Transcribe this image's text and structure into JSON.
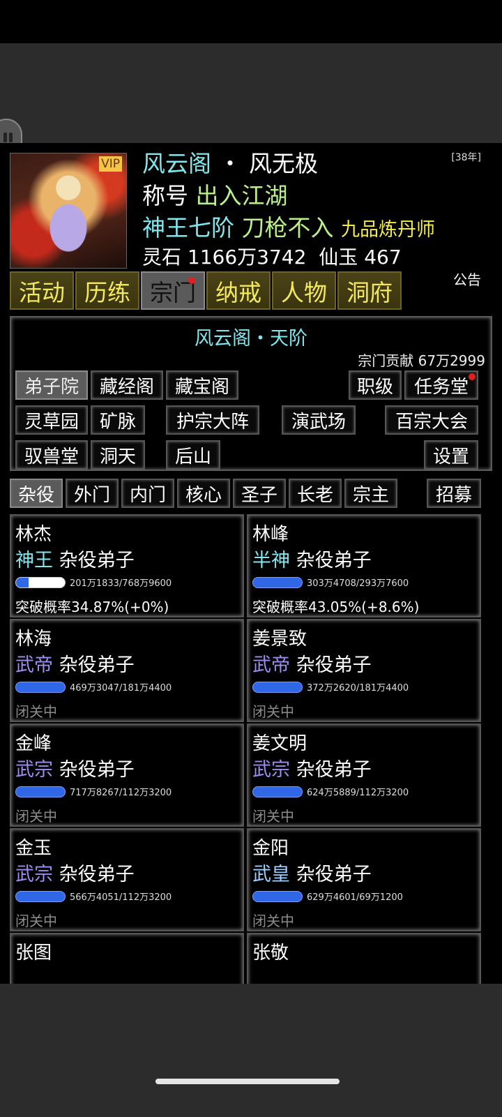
{
  "header": {
    "sect": "风云阁",
    "dot": "・",
    "player": "风无极",
    "title_label": "称号",
    "title_value": "出入江湖",
    "realm": "神王七阶",
    "trait": "刀枪不入",
    "profession": "九品炼丹师",
    "spirit_label": "灵石",
    "spirit_value": "1166万3742",
    "jade_label": "仙玉",
    "jade_value": "467",
    "years": "[38年]",
    "vip": "VIP",
    "notice": "公告"
  },
  "nav_tabs": [
    "活动",
    "历练",
    "宗门",
    "纳戒",
    "人物",
    "洞府"
  ],
  "nav_active": "宗门",
  "panel": {
    "title": "风云阁・天阶",
    "contribution": "宗门贡献 67万2999",
    "buttons": {
      "disciple": "弟子院",
      "scripture": "藏经阁",
      "treasure": "藏宝阁",
      "rank": "职级",
      "mission": "任务堂",
      "herb": "灵草园",
      "mine": "矿脉",
      "formation": "护宗大阵",
      "arena": "演武场",
      "tournament": "百宗大会",
      "beast": "驭兽堂",
      "cave": "洞天",
      "mountain": "后山",
      "settings": "设置"
    }
  },
  "rank_tabs": [
    "杂役",
    "外门",
    "内门",
    "核心",
    "圣子",
    "长老",
    "宗主"
  ],
  "recruit": "招募",
  "disciples": [
    {
      "name": "林杰",
      "realm": "神王",
      "role": "杂役弟子",
      "progress_text": "201万1833/768万9600",
      "progress": 0.26,
      "status": "突破概率34.87%(+0%)"
    },
    {
      "name": "林峰",
      "realm": "半神",
      "role": "杂役弟子",
      "progress_text": "303万4708/293万7600",
      "progress": 1.0,
      "status": "突破概率43.05%(+8.6%)"
    },
    {
      "name": "林海",
      "realm": "武帝",
      "role": "杂役弟子",
      "progress_text": "469万3047/181万4400",
      "progress": 1.0,
      "status": "闭关中"
    },
    {
      "name": "姜景致",
      "realm": "武帝",
      "role": "杂役弟子",
      "progress_text": "372万2620/181万4400",
      "progress": 1.0,
      "status": "闭关中"
    },
    {
      "name": "金峰",
      "realm": "武宗",
      "role": "杂役弟子",
      "progress_text": "717万8267/112万3200",
      "progress": 1.0,
      "status": "闭关中"
    },
    {
      "name": "姜文明",
      "realm": "武宗",
      "role": "杂役弟子",
      "progress_text": "624万5889/112万3200",
      "progress": 1.0,
      "status": "闭关中"
    },
    {
      "name": "金玉",
      "realm": "武宗",
      "role": "杂役弟子",
      "progress_text": "566万4051/112万3200",
      "progress": 1.0,
      "status": "闭关中"
    },
    {
      "name": "金阳",
      "realm": "武皇",
      "role": "杂役弟子",
      "progress_text": "629万4601/69万1200",
      "progress": 1.0,
      "status": "闭关中"
    },
    {
      "name": "张图"
    },
    {
      "name": "张敬"
    }
  ]
}
